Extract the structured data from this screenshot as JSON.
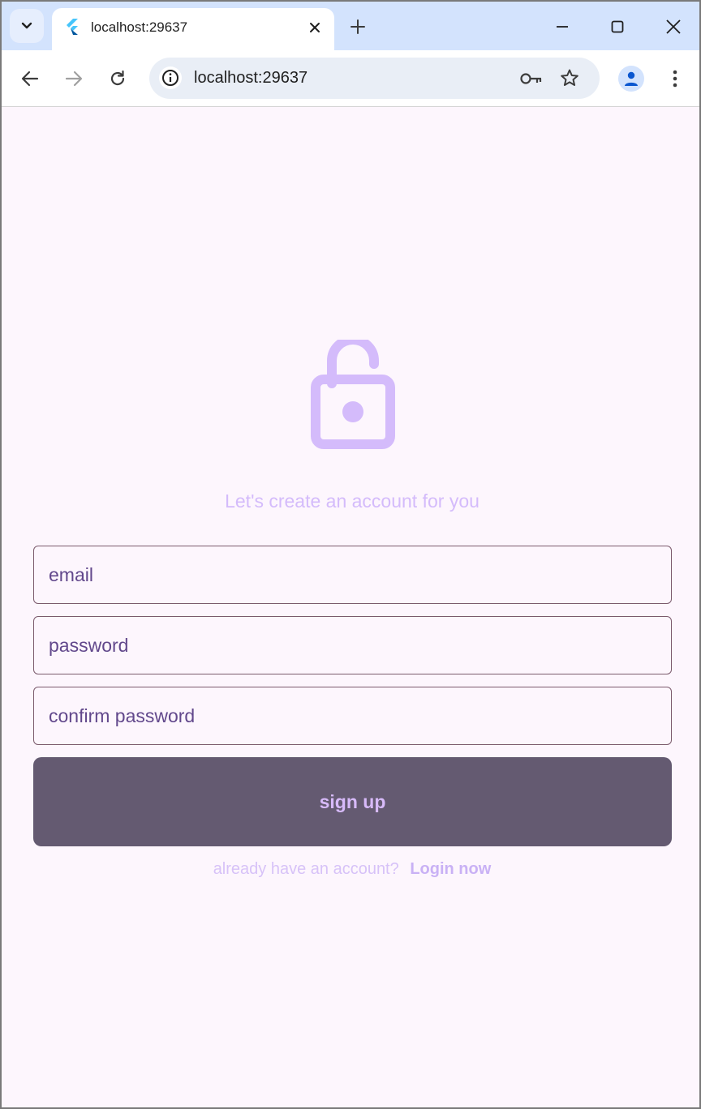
{
  "browser": {
    "tab": {
      "title": "localhost:29637"
    },
    "omnibox": {
      "url": "localhost:29637"
    }
  },
  "page": {
    "subtitle": "Let's create an account for you",
    "fields": {
      "email_placeholder": "email",
      "password_placeholder": "password",
      "confirm_placeholder": "confirm password"
    },
    "signup_label": "sign up",
    "login_prompt": "already have an account?",
    "login_link": "Login now"
  },
  "icons": {
    "tab_search": "chevron-down-icon",
    "favicon": "flutter-icon",
    "tab_close": "close-icon",
    "new_tab": "plus-icon",
    "minimize": "minimize-icon",
    "maximize": "maximize-icon",
    "close_window": "close-icon",
    "back": "arrow-left-icon",
    "forward": "arrow-right-icon",
    "reload": "reload-icon",
    "site_info": "info-icon",
    "passwords": "key-icon",
    "bookmark": "star-icon",
    "profile": "person-icon",
    "menu": "more-vert-icon",
    "hero": "lock-open-icon"
  },
  "colors": {
    "page_bg": "#fdf6fd",
    "accent": "#d4bbfb",
    "button_bg": "#645a71",
    "field_border": "#7b5a6c",
    "tabstrip": "#d3e3fd"
  }
}
